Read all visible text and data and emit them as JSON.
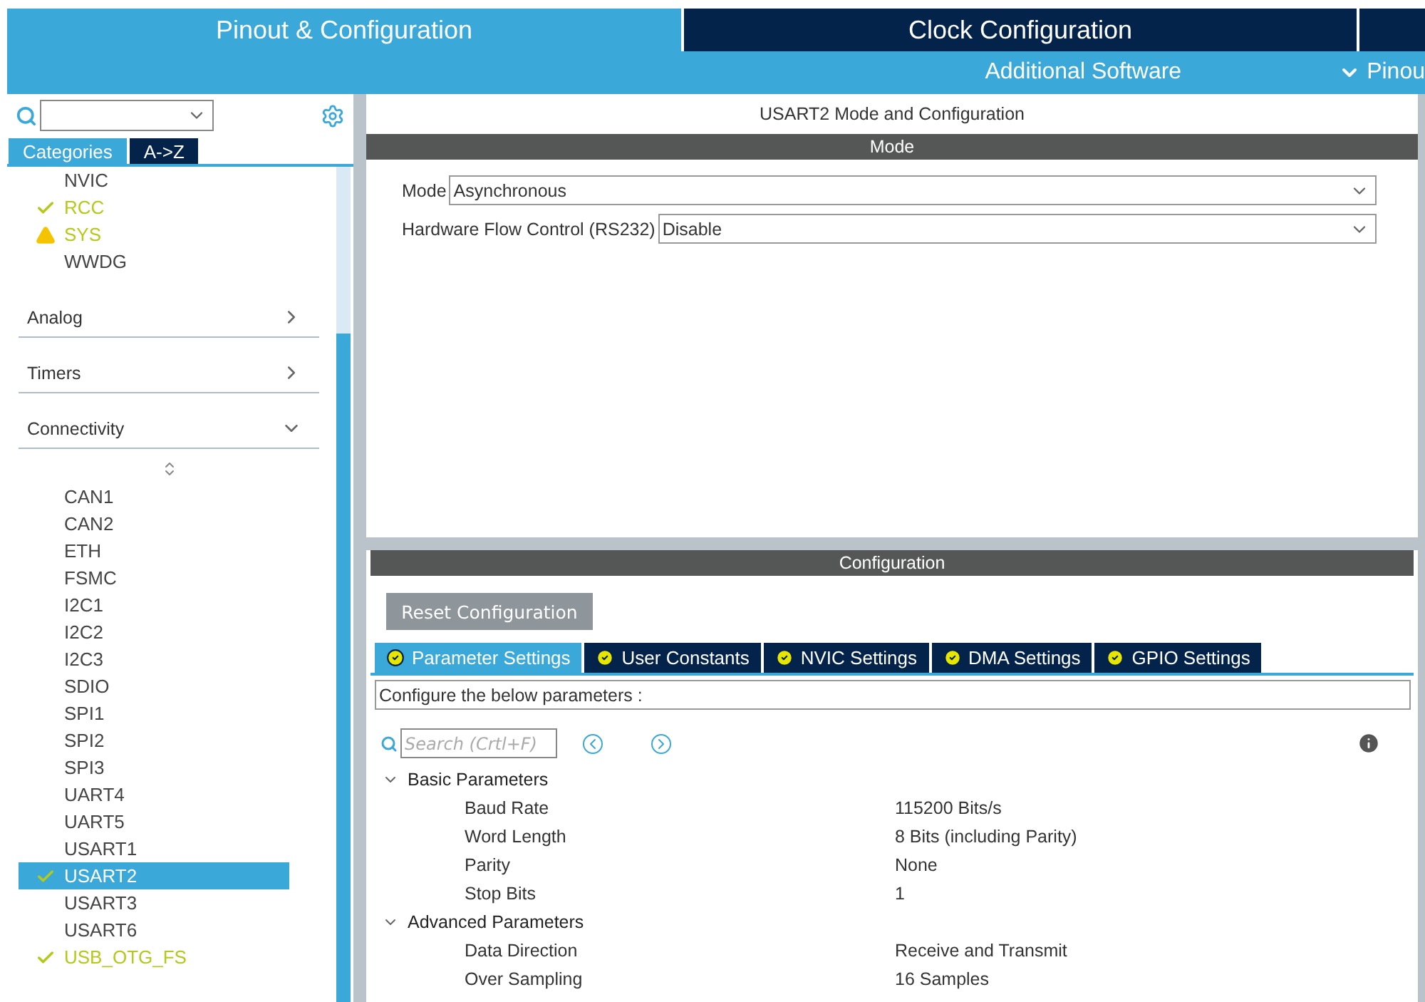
{
  "top_tabs": [
    {
      "label": "Pinout & Configuration",
      "selected": true
    },
    {
      "label": "Clock Configuration",
      "selected": false
    }
  ],
  "sub_tabs": [
    {
      "label": "Additional Software",
      "dropdown": false
    },
    {
      "label": "Pinou",
      "dropdown": true
    }
  ],
  "sidebar": {
    "view_tabs": [
      {
        "label": "Categories",
        "selected": true
      },
      {
        "label": "A->Z",
        "selected": false
      }
    ],
    "top_items": [
      {
        "name": "NVIC",
        "kind": "plain"
      },
      {
        "name": "RCC",
        "kind": "ok"
      },
      {
        "name": "SYS",
        "kind": "warning"
      },
      {
        "name": "WWDG",
        "kind": "plain"
      }
    ],
    "categories": [
      {
        "name": "Analog",
        "expanded": false
      },
      {
        "name": "Timers",
        "expanded": false
      },
      {
        "name": "Connectivity",
        "expanded": true
      }
    ],
    "items": [
      {
        "name": "CAN1",
        "kind": "plain",
        "selected": false
      },
      {
        "name": "CAN2",
        "kind": "plain",
        "selected": false
      },
      {
        "name": "ETH",
        "kind": "plain",
        "selected": false
      },
      {
        "name": "FSMC",
        "kind": "plain",
        "selected": false
      },
      {
        "name": "I2C1",
        "kind": "plain",
        "selected": false
      },
      {
        "name": "I2C2",
        "kind": "plain",
        "selected": false
      },
      {
        "name": "I2C3",
        "kind": "plain",
        "selected": false
      },
      {
        "name": "SDIO",
        "kind": "plain",
        "selected": false
      },
      {
        "name": "SPI1",
        "kind": "plain",
        "selected": false
      },
      {
        "name": "SPI2",
        "kind": "plain",
        "selected": false
      },
      {
        "name": "SPI3",
        "kind": "plain",
        "selected": false
      },
      {
        "name": "UART4",
        "kind": "plain",
        "selected": false
      },
      {
        "name": "UART5",
        "kind": "plain",
        "selected": false
      },
      {
        "name": "USART1",
        "kind": "plain",
        "selected": false
      },
      {
        "name": "USART2",
        "kind": "ok",
        "selected": true
      },
      {
        "name": "USART3",
        "kind": "plain",
        "selected": false
      },
      {
        "name": "USART6",
        "kind": "plain",
        "selected": false
      },
      {
        "name": "USB_OTG_FS",
        "kind": "ok",
        "selected": false
      }
    ]
  },
  "panel": {
    "title": "USART2 Mode and Configuration",
    "mode_header": "Mode",
    "mode_fields": [
      {
        "label": "Mode",
        "value": "Asynchronous"
      },
      {
        "label": "Hardware Flow Control (RS232)",
        "value": "Disable"
      }
    ],
    "config_header": "Configuration",
    "reset_button": "Reset Configuration",
    "config_tabs": [
      {
        "label": "Parameter Settings",
        "selected": true
      },
      {
        "label": "User Constants",
        "selected": false
      },
      {
        "label": "NVIC Settings",
        "selected": false
      },
      {
        "label": "DMA Settings",
        "selected": false
      },
      {
        "label": "GPIO Settings",
        "selected": false
      }
    ],
    "description": "Configure the below parameters :",
    "search": {
      "placeholder": "Search (Crtl+F)"
    },
    "groups": [
      {
        "name": "Basic Parameters",
        "expanded": true,
        "params": [
          {
            "name": "Baud Rate",
            "value": "115200 Bits/s"
          },
          {
            "name": "Word Length",
            "value": "8 Bits (including Parity)"
          },
          {
            "name": "Parity",
            "value": "None"
          },
          {
            "name": "Stop Bits",
            "value": "1"
          }
        ]
      },
      {
        "name": "Advanced Parameters",
        "expanded": true,
        "params": [
          {
            "name": "Data Direction",
            "value": "Receive and Transmit"
          },
          {
            "name": "Over Sampling",
            "value": "16 Samples"
          }
        ]
      }
    ]
  }
}
